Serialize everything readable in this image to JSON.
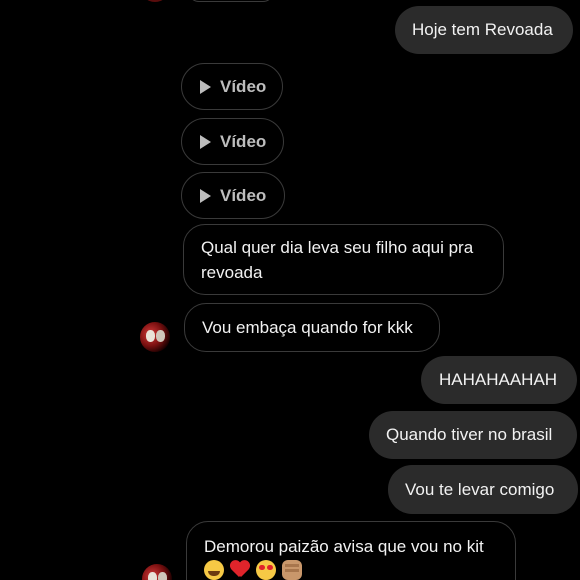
{
  "messages": {
    "m1": "Hoje tem Revoada",
    "video_label": "Vídeo",
    "m2": "Qual quer dia leva seu filho aqui pra revoada",
    "m3": "Vou embaça quando for kkk",
    "m4": "HAHAHAAHAH",
    "m5": "Quando tiver no brasil",
    "m6": "Vou te levar comigo",
    "m7": "Demorou paizão avisa que vou no kit"
  },
  "reactions": [
    "face-with-tears-of-joy",
    "red-heart",
    "smiling-face-with-heart-eyes",
    "oncoming-fist"
  ],
  "colors": {
    "background": "#000000",
    "outgoing_bubble": "#2b2b2b",
    "incoming_border": "#3a3a3a",
    "text": "#f2f2f2"
  }
}
